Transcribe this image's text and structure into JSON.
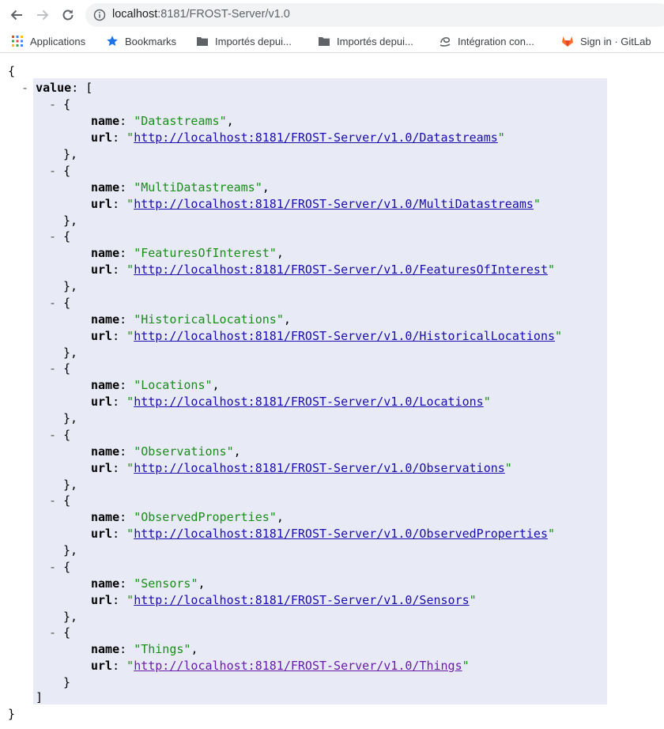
{
  "browser": {
    "url_host": "localhost",
    "url_rest": ":8181/FROST-Server/v1.0"
  },
  "bookmarks": [
    {
      "label": "Applications",
      "icon": "apps-grid-icon"
    },
    {
      "label": "Bookmarks",
      "icon": "star-icon"
    },
    {
      "label": "Importés depui...",
      "icon": "folder-icon"
    },
    {
      "label": "Importés depui...",
      "icon": "folder-icon"
    },
    {
      "label": "Intégration con...",
      "icon": "swirl-icon"
    },
    {
      "label": "Sign in · GitLab",
      "icon": "gitlab-icon"
    }
  ],
  "json": {
    "open_brace": "{",
    "close_brace": "}",
    "toggle": "-",
    "root_key": "value",
    "open_bracket": "[",
    "close_bracket": "]",
    "name_key": "name",
    "url_key": "url",
    "entries": [
      {
        "name": "Datastreams",
        "url": "http://localhost:8181/FROST-Server/v1.0/Datastreams"
      },
      {
        "name": "MultiDatastreams",
        "url": "http://localhost:8181/FROST-Server/v1.0/MultiDatastreams"
      },
      {
        "name": "FeaturesOfInterest",
        "url": "http://localhost:8181/FROST-Server/v1.0/FeaturesOfInterest"
      },
      {
        "name": "HistoricalLocations",
        "url": "http://localhost:8181/FROST-Server/v1.0/HistoricalLocations"
      },
      {
        "name": "Locations",
        "url": "http://localhost:8181/FROST-Server/v1.0/Locations"
      },
      {
        "name": "Observations",
        "url": "http://localhost:8181/FROST-Server/v1.0/Observations"
      },
      {
        "name": "ObservedProperties",
        "url": "http://localhost:8181/FROST-Server/v1.0/ObservedProperties"
      },
      {
        "name": "Sensors",
        "url": "http://localhost:8181/FROST-Server/v1.0/Sensors"
      },
      {
        "name": "Things",
        "url": "http://localhost:8181/FROST-Server/v1.0/Things"
      }
    ]
  }
}
